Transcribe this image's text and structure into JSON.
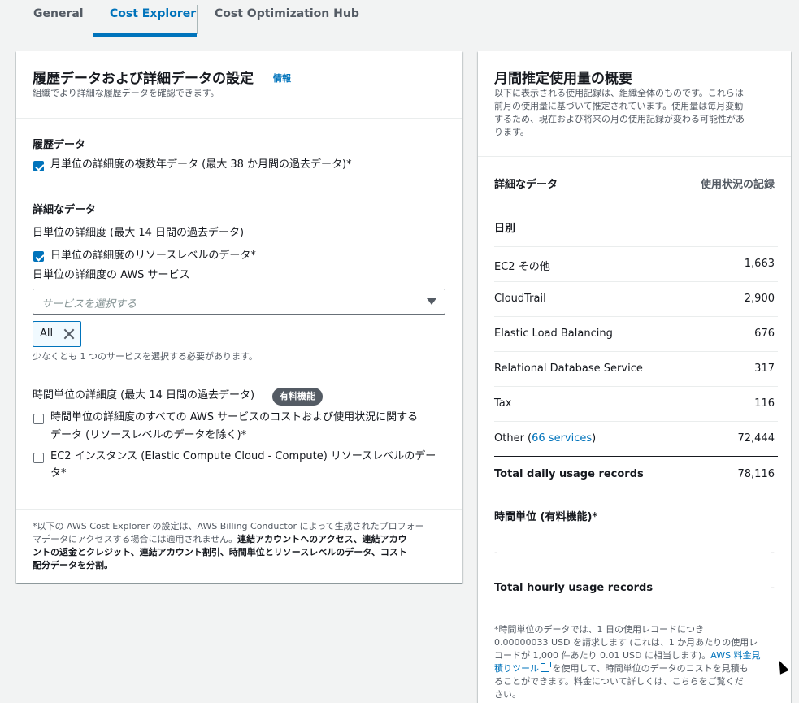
{
  "tabs": [
    {
      "label": "General"
    },
    {
      "label": "Cost Explorer",
      "active": true
    },
    {
      "label": "Cost Optimization Hub"
    }
  ],
  "left": {
    "title": "履歴データおよび詳細データの設定",
    "info": "情報",
    "subtitle": "組織でより詳細な履歴データを確認できます。",
    "history": {
      "title": "履歴データ",
      "checkbox_label": "月単位の詳細度の複数年データ (最大 38 か月間の過去データ)*",
      "checked": true
    },
    "detail": {
      "title": "詳細なデータ",
      "daily_label": "日単位の詳細度 (最大 14 日間の過去データ)",
      "daily_resource_label": "日単位の詳細度のリソースレベルのデータ*",
      "daily_resource_checked": true,
      "aws_services_label": "日単位の詳細度の AWS サービス",
      "select_placeholder": "サービスを選択する",
      "token": "All",
      "hint": "少なくとも 1 つのサービスを選択する必要があります。",
      "hourly_label": "時間単位の詳細度 (最大 14 日間の過去データ)",
      "paid_badge": "有料機能",
      "hourly_all_line1": "時間単位の詳細度のすべての AWS サービスのコストおよび使用状況に関する",
      "hourly_all_line2": "データ (リソースレベルのデータを除く)*",
      "hourly_ec2_line1": "EC2 インスタンス (Elastic Compute Cloud - Compute) リソースレベルのデー",
      "hourly_ec2_line2": "タ*"
    },
    "footnote": {
      "line1": "*以下の AWS Cost Explorer の設定は、AWS Billing Conductor によって生成されたプロフォー",
      "line2a": "マデータにアクセスする場合には適用されません。",
      "line2b": "連結アカウントへのアクセス、連結アカウ",
      "line3": "ントの返金とクレジット、連結アカウント割引、時間単位とリソースレベルのデータ、コスト",
      "line4": "配分データを分割。"
    }
  },
  "right": {
    "title": "月間推定使用量の概要",
    "desc": [
      "以下に表示される使用記録は、組織全体のものです。これらは",
      "前月の使用量に基づいて推定されています。使用量は毎月変動",
      "するため、現在および将来の月の使用記録が変わる可能性があ",
      "ります。"
    ],
    "col_detail": "詳細なデータ",
    "col_records": "使用状況の記録",
    "daily_section": "日別",
    "rows": [
      {
        "name": "EC2 その他",
        "value": "1,663"
      },
      {
        "name": "CloudTrail",
        "value": "2,900"
      },
      {
        "name": "Elastic Load Balancing",
        "value": "676"
      },
      {
        "name": "Relational Database Service",
        "value": "317"
      },
      {
        "name": "Tax",
        "value": "116"
      }
    ],
    "other_prefix": "Other (",
    "other_link": "66 services",
    "other_suffix": ")",
    "other_value": "72,444",
    "total_daily_label": "Total daily usage records",
    "total_daily_value": "78,116",
    "hourly_section": "時間単位 (有料機能)*",
    "hourly_row_name": "-",
    "hourly_row_value": "-",
    "total_hourly_label": "Total hourly usage records",
    "total_hourly_value": "-",
    "note": {
      "line1": "*時間単位のデータでは、1 日の使用レコードにつき",
      "line2": "0.00000033 USD を請求します (これは、1 か月あたりの使用レ",
      "line3a": "コードが 1,000 件あたり 0.01 USD に相当します)。",
      "line3b": "AWS 料金見",
      "line4a": "積りツール",
      "line4b": " を使用して、時間単位のデータのコストを見積も",
      "line5": "ることができます。料金について詳しくは、こちらをご覧くだ",
      "line6": "さい。"
    }
  }
}
